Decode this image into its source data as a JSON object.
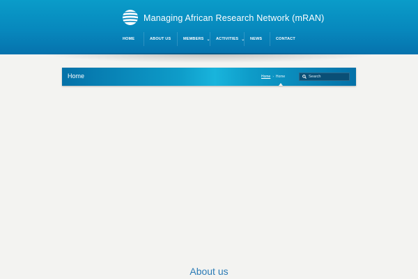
{
  "site": {
    "title": "Managing African Research Network (mRAN)"
  },
  "nav": {
    "items": [
      {
        "label": "HOME",
        "has_dropdown": false
      },
      {
        "label": "ABOUT US",
        "has_dropdown": false
      },
      {
        "label": "MEMBERS",
        "has_dropdown": true
      },
      {
        "label": "ACTIVITIES",
        "has_dropdown": true
      },
      {
        "label": "NEWS",
        "has_dropdown": false
      },
      {
        "label": "CONTACT",
        "has_dropdown": false
      }
    ]
  },
  "page": {
    "title": "Home",
    "breadcrumb": {
      "link": "Home",
      "current": "Home"
    }
  },
  "search": {
    "placeholder": "Search"
  },
  "section": {
    "heading": "About us"
  },
  "icons": {
    "logo": "globe-icon",
    "search": "search-icon",
    "dropdown": "chevron-down-icon"
  },
  "colors": {
    "header": "#0788bd",
    "accent": "#19b4dc",
    "heading": "#2b7bb6",
    "background": "#f3f3f1"
  }
}
